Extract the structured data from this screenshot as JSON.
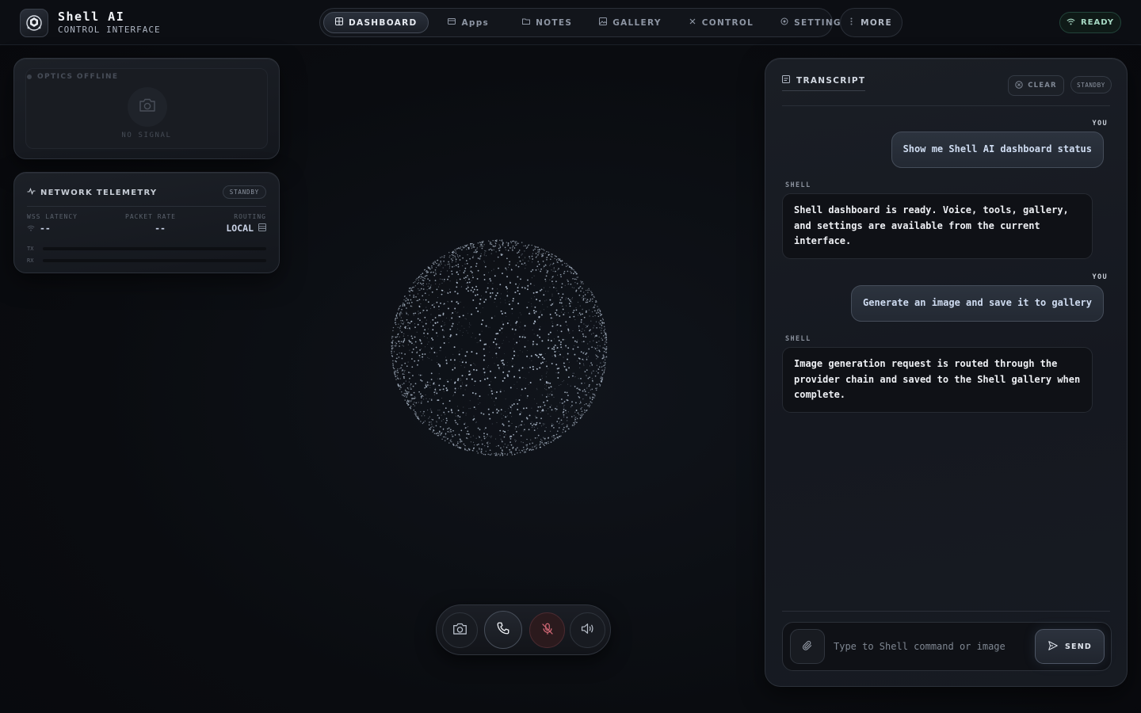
{
  "brand": {
    "title": "Shell AI",
    "subtitle": "CONTROL INTERFACE",
    "logo_icon": "cube-logo-icon"
  },
  "nav": {
    "items": [
      {
        "label": "DASHBOARD",
        "icon": "grid-icon",
        "active": true
      },
      {
        "label": "Apps",
        "icon": "window-icon",
        "active": false
      },
      {
        "label": "NOTES",
        "icon": "folder-icon",
        "active": false
      },
      {
        "label": "GALLERY",
        "icon": "image-icon",
        "active": false
      },
      {
        "label": "CONTROL",
        "icon": "tools-icon",
        "active": false
      },
      {
        "label": "SETTINGS",
        "icon": "gear-icon",
        "active": false
      }
    ],
    "more_label": "MORE"
  },
  "status": {
    "label": "READY",
    "icon": "wifi-icon",
    "color": "#a7d9c4"
  },
  "optics": {
    "label": "OPTICS OFFLINE",
    "signal": "NO SIGNAL"
  },
  "telemetry": {
    "title": "NETWORK TELEMETRY",
    "badge": "STANDBY",
    "latency_label": "WSS LATENCY",
    "latency_value": "--",
    "packet_label": "PACKET RATE",
    "packet_value": "--",
    "routing_label": "ROUTING",
    "routing_value": "LOCAL",
    "tx_label": "TX",
    "rx_label": "RX",
    "tx_fraction": 0,
    "rx_fraction": 0
  },
  "dock": {
    "buttons": [
      "camera-icon",
      "phone-icon",
      "mic-off-icon",
      "speaker-icon"
    ]
  },
  "transcript": {
    "title": "TRANSCRIPT",
    "clear_label": "CLEAR",
    "state_badge": "STANDBY",
    "messages": [
      {
        "role": "YOU",
        "text": "Show me Shell AI dashboard status"
      },
      {
        "role": "SHELL",
        "text": "Shell dashboard is ready. Voice, tools, gallery, and settings are available from the current interface."
      },
      {
        "role": "YOU",
        "text": "Generate an image and save it to gallery"
      },
      {
        "role": "SHELL",
        "text": "Image generation request is routed through the provider chain and saved to the Shell gallery when complete."
      }
    ],
    "input_placeholder": "Type to Shell command or image",
    "input_value": "",
    "send_label": "SEND"
  },
  "colors": {
    "accent": "#cfdcf1",
    "mic_muted": "#d66a78",
    "background": "#0b0d12"
  }
}
